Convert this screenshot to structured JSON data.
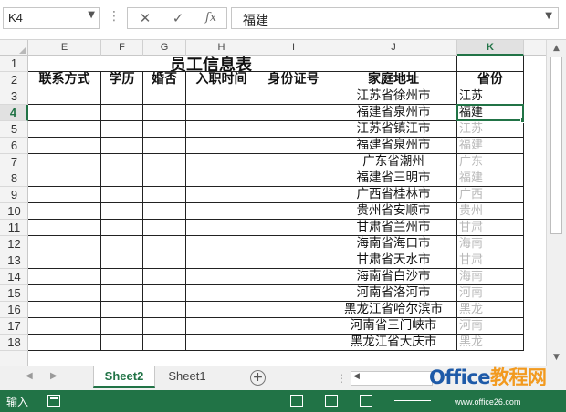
{
  "formula_bar": {
    "name_box": "K4",
    "cancel_glyph": "✕",
    "enter_glyph": "✓",
    "fx_glyph": "fx",
    "content": "福建"
  },
  "columns": [
    "E",
    "F",
    "G",
    "H",
    "I",
    "J",
    "K"
  ],
  "selected_column": "K",
  "rows": [
    "1",
    "2",
    "3",
    "4",
    "5",
    "6",
    "7",
    "8",
    "9",
    "10",
    "11",
    "12",
    "13",
    "14",
    "15",
    "16",
    "17",
    "18"
  ],
  "selected_row": "4",
  "sheet": {
    "title": "员工信息表",
    "headers": [
      "联系方式",
      "学历",
      "婚否",
      "入职时间",
      "身份证号",
      "家庭地址",
      "省份"
    ],
    "addresses": [
      "江苏省徐州市",
      "福建省泉州市",
      "江苏省镇江市",
      "福建省泉州市",
      "广东省潮州",
      "福建省三明市",
      "广西省桂林市",
      "贵州省安顺市",
      "甘肃省兰州市",
      "海南省海口市",
      "甘肃省天水市",
      "海南省白沙市",
      "河南省洛河市",
      "黑龙江省哈尔滨市",
      "河南省三门峡市",
      "黑龙江省大庆市"
    ],
    "provinces": [
      "江苏",
      "福建",
      "江苏",
      "福建",
      "广东",
      "福建",
      "广西",
      "贵州",
      "甘肃",
      "海南",
      "甘肃",
      "海南",
      "河南",
      "黑龙",
      "河南",
      "黑龙"
    ]
  },
  "tabs": {
    "items": [
      "Sheet2",
      "Sheet1"
    ],
    "active": "Sheet2",
    "add_glyph": "+"
  },
  "status": {
    "mode": "输入"
  },
  "watermark": {
    "brand_part1": "Office",
    "brand_part2": "教程网",
    "url": "www.office26.com"
  },
  "colors": {
    "accent": "#217346",
    "dim_text": "#b8b8b8"
  }
}
